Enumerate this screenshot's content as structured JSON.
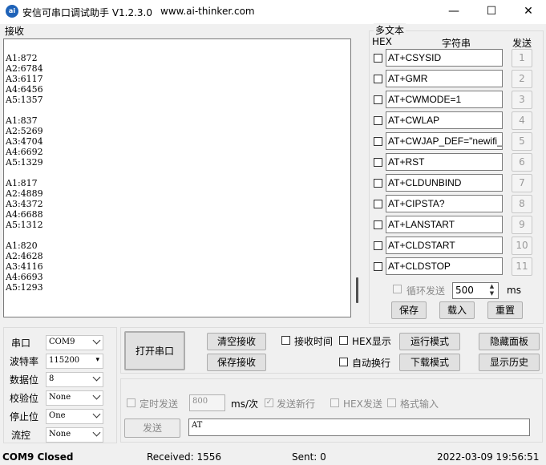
{
  "window": {
    "title": "安信可串口调试助手 V1.2.3.0",
    "url": "www.ai-thinker.com",
    "logo": "ai",
    "minimize_icon": "—",
    "maximize_icon": "☐",
    "close_icon": "✕"
  },
  "receive": {
    "label": "接收",
    "text": "A1:872\nA2:6784\nA3:6117\nA4:6456\nA5:1357\n\nA1:837\nA2:5269\nA3:4704\nA4:6692\nA5:1329\n\nA1:817\nA2:4889\nA3:4372\nA4:6688\nA5:1312\n\nA1:820\nA2:4628\nA3:4116\nA4:6693\nA5:1293"
  },
  "multi_text": {
    "title": "多文本",
    "headers": {
      "hex": "HEX",
      "string": "字符串",
      "send": "发送"
    },
    "rows": [
      {
        "value": "AT+CSYSID",
        "num": "1"
      },
      {
        "value": "AT+GMR",
        "num": "2"
      },
      {
        "value": "AT+CWMODE=1",
        "num": "3"
      },
      {
        "value": "AT+CWLAP",
        "num": "4"
      },
      {
        "value": "AT+CWJAP_DEF=\"newifi_",
        "num": "5"
      },
      {
        "value": "AT+RST",
        "num": "6"
      },
      {
        "value": "AT+CLDUNBIND",
        "num": "7"
      },
      {
        "value": "AT+CIPSTA?",
        "num": "8"
      },
      {
        "value": "AT+LANSTART",
        "num": "9"
      },
      {
        "value": "AT+CLDSTART",
        "num": "10"
      },
      {
        "value": "AT+CLDSTOP",
        "num": "11"
      }
    ],
    "loop_label": "循环发送",
    "loop_value": "500",
    "loop_unit": "ms",
    "save": "保存",
    "load": "载入",
    "reset": "重置"
  },
  "settings": {
    "port_label": "串口",
    "port": "COM9",
    "baud_label": "波特率",
    "baud": "115200",
    "databits_label": "数据位",
    "databits": "8",
    "parity_label": "校验位",
    "parity": "None",
    "stopbits_label": "停止位",
    "stopbits": "One",
    "flow_label": "流控",
    "flow": "None"
  },
  "controls": {
    "open_port": "打开串口",
    "clear_recv": "清空接收",
    "save_recv": "保存接收",
    "recv_time": "接收时间",
    "hex_display": "HEX显示",
    "auto_newline": "自动换行",
    "run_mode": "运行模式",
    "download_mode": "下载模式",
    "hide_panel": "隐藏面板",
    "show_history": "显示历史"
  },
  "send": {
    "timed_send": "定时发送",
    "timed_value": "800",
    "timed_unit": "ms/次",
    "send_newline": "发送新行",
    "hex_send": "HEX发送",
    "format_input": "格式输入",
    "send_button": "发送",
    "input_value": "AT"
  },
  "status": {
    "port_state": "COM9 Closed",
    "received": "Received: 1556",
    "sent": "Sent: 0",
    "datetime": "2022-03-09 19:56:51"
  }
}
